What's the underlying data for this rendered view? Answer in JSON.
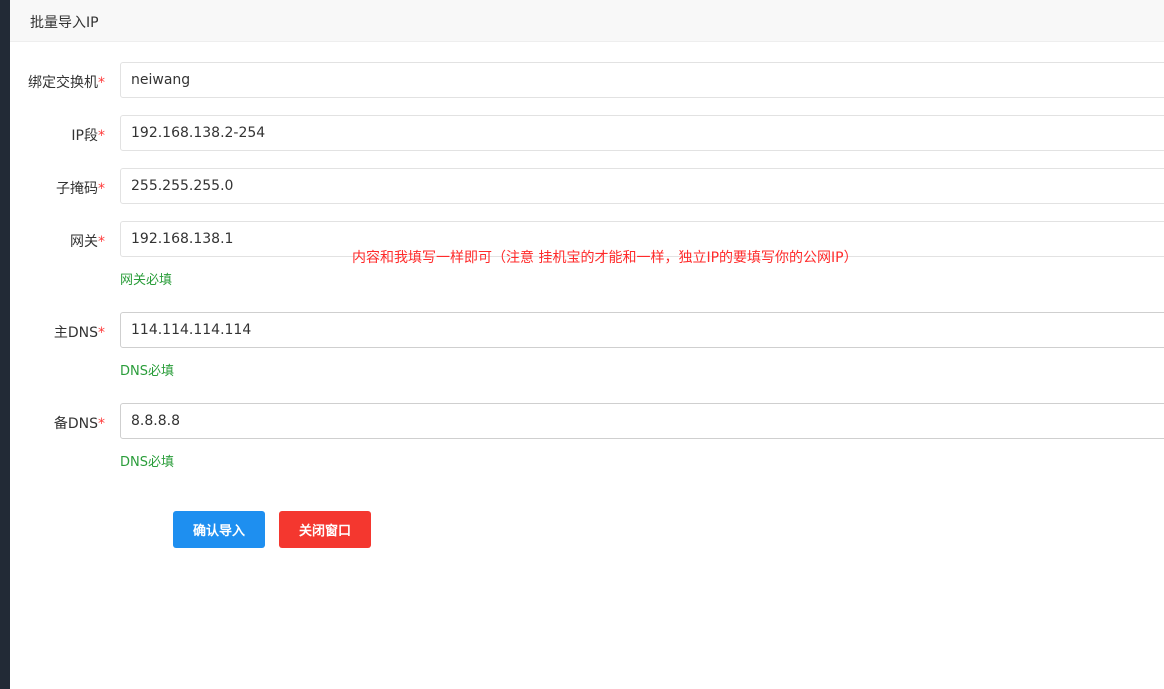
{
  "modal": {
    "title": "批量导入IP"
  },
  "form": {
    "required_mark": "*",
    "fields": [
      {
        "label": "绑定交换机",
        "value": "neiwang",
        "hint": ""
      },
      {
        "label": "IP段",
        "value": "192.168.138.2-254",
        "hint": ""
      },
      {
        "label": "子掩码",
        "value": "255.255.255.0",
        "hint": ""
      },
      {
        "label": "网关",
        "value": "192.168.138.1",
        "hint": "网关必填"
      },
      {
        "label": "主DNS",
        "value": "114.114.114.114",
        "hint": "DNS必填"
      },
      {
        "label": "备DNS",
        "value": "8.8.8.8",
        "hint": "DNS必填"
      }
    ]
  },
  "annotation": "内容和我填写一样即可（注意 挂机宝的才能和一样，独立IP的要填写你的公网IP）",
  "buttons": {
    "confirm": "确认导入",
    "close": "关闭窗口"
  },
  "colors": {
    "confirm_button": "#1e8ff0",
    "close_button": "#f4372f",
    "hint_text": "#2a9d3a",
    "annotation_text": "#ff2b2b",
    "required_mark": "#ff3b3b"
  }
}
